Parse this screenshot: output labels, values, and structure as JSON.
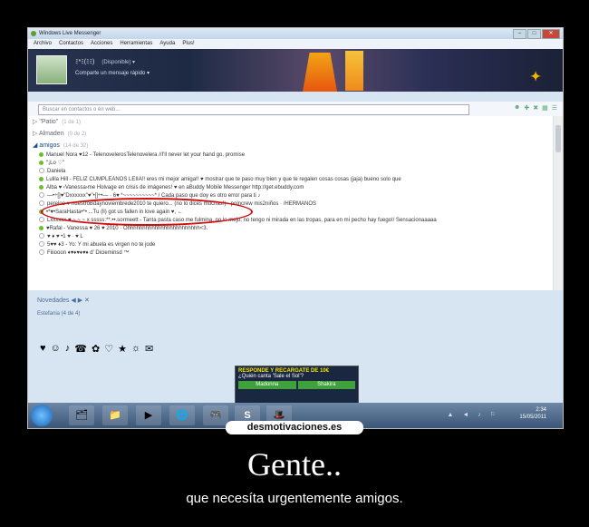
{
  "window": {
    "title": "Windows Live Messenger",
    "controls": [
      "–",
      "□",
      "✕"
    ]
  },
  "menu": [
    "Archivo",
    "Contactos",
    "Acciones",
    "Herramientas",
    "Ayuda",
    "Plus!"
  ],
  "profile": {
    "name": "ﾐ*ﾐ(ﾐﾐ)",
    "status": "(Disponible) ▾",
    "personal_message": "Comparte un mensaje rápido ▾"
  },
  "search": {
    "placeholder": "Buscar en contactos o en web...",
    "icons": [
      "contacts-icon",
      "add-contact-icon",
      "games-icon",
      "layout-icon",
      "options-icon"
    ]
  },
  "groups": [
    {
      "name": "\"Patio\"",
      "count": "(1 de 1)"
    },
    {
      "name": "Almaden",
      "count": "(0 de 2)"
    },
    {
      "name": "amigos",
      "count": "(14 de 32)"
    }
  ],
  "contacts": [
    "Manuel          Nora ♥12  - TelenovelerosTelenovelera //I'll never let your hand go, promise",
    "\"¡Lo ♡\"",
    "Daniela",
    "Lulila Hill - FELIZ CUMPLEAÑOS LEIIA!! eres mi mejor amiga!! ♥ mostrar que te paso muy bien y que te regalen cosas cosas (jaja) bueno solo que",
    "Alba ♥ ‹Vanessa›me Holvage en crisis de imágenes! ♥ en aBuddy Mobile Messenger http://get.ebuddy.com",
    "—•÷[]♥\"Dxxxxxx\"♥\"•[]÷•— · 6♥ *~~~~~~~~~~* / Cada paso que doy es otro error para ti ♪",
    "pereloo ♥   nuestroBdaynoviembrede2010   te quiero... (no lo dices muchas!)  · poincrew  mis2niños  · /HERMANOS",
    "•*♥•SaraHasta•*•   ...Tu (ll) got us fallen in love again ♥, ←",
    "Lxxxxxx  ♥   ~ ~ ~ x  sssss:**.••.sormeett  -  Tanta pasta caso me fulmina, no lo mejo, no tengo ni mirada en las tropas, para en mi pecho hay fuego!/ Sensacionaaaaa",
    "♥Rafal - Vanessa ♥ 26 ♥ 2010  ·  Ohhhhhhhhhhhhhhhhhhhhhhhh<3.",
    "♥ ♦ ♥  •1 ♥  · ♥ L",
    "5♥♥  ♦3  -  Yo: Y mi abuela es virgen no te jode",
    "Fiiiooon  ♦♥♦♥♦♥♦  d' Dicieminsd ™"
  ],
  "news": {
    "label": "Novedades",
    "sub": "Estefania (4 de 4)"
  },
  "emoticons": [
    "♥",
    "☺",
    "♪",
    "☎",
    "✿",
    "♡",
    "★",
    "☼",
    "✉"
  ],
  "ad": {
    "header": "RESPONDE Y RECARGATE DE 10€",
    "question": "¿Quién canta 'Sale el Sol'?",
    "options": [
      "Madonna",
      "Shakira"
    ]
  },
  "taskbar": {
    "time": "2:34",
    "date": "15/05/2011",
    "apps": [
      "🗂",
      "📁",
      "▶",
      "🌐",
      "🎮",
      "S",
      "🎩"
    ]
  },
  "watermark": "desmotivaciones.es",
  "caption": "Gente..",
  "subcaption": "que necesíta urgentemente amigos.",
  "colors": {
    "banner": "#2a3353",
    "accent": "#d01010",
    "taskbar": "#3b5576"
  }
}
